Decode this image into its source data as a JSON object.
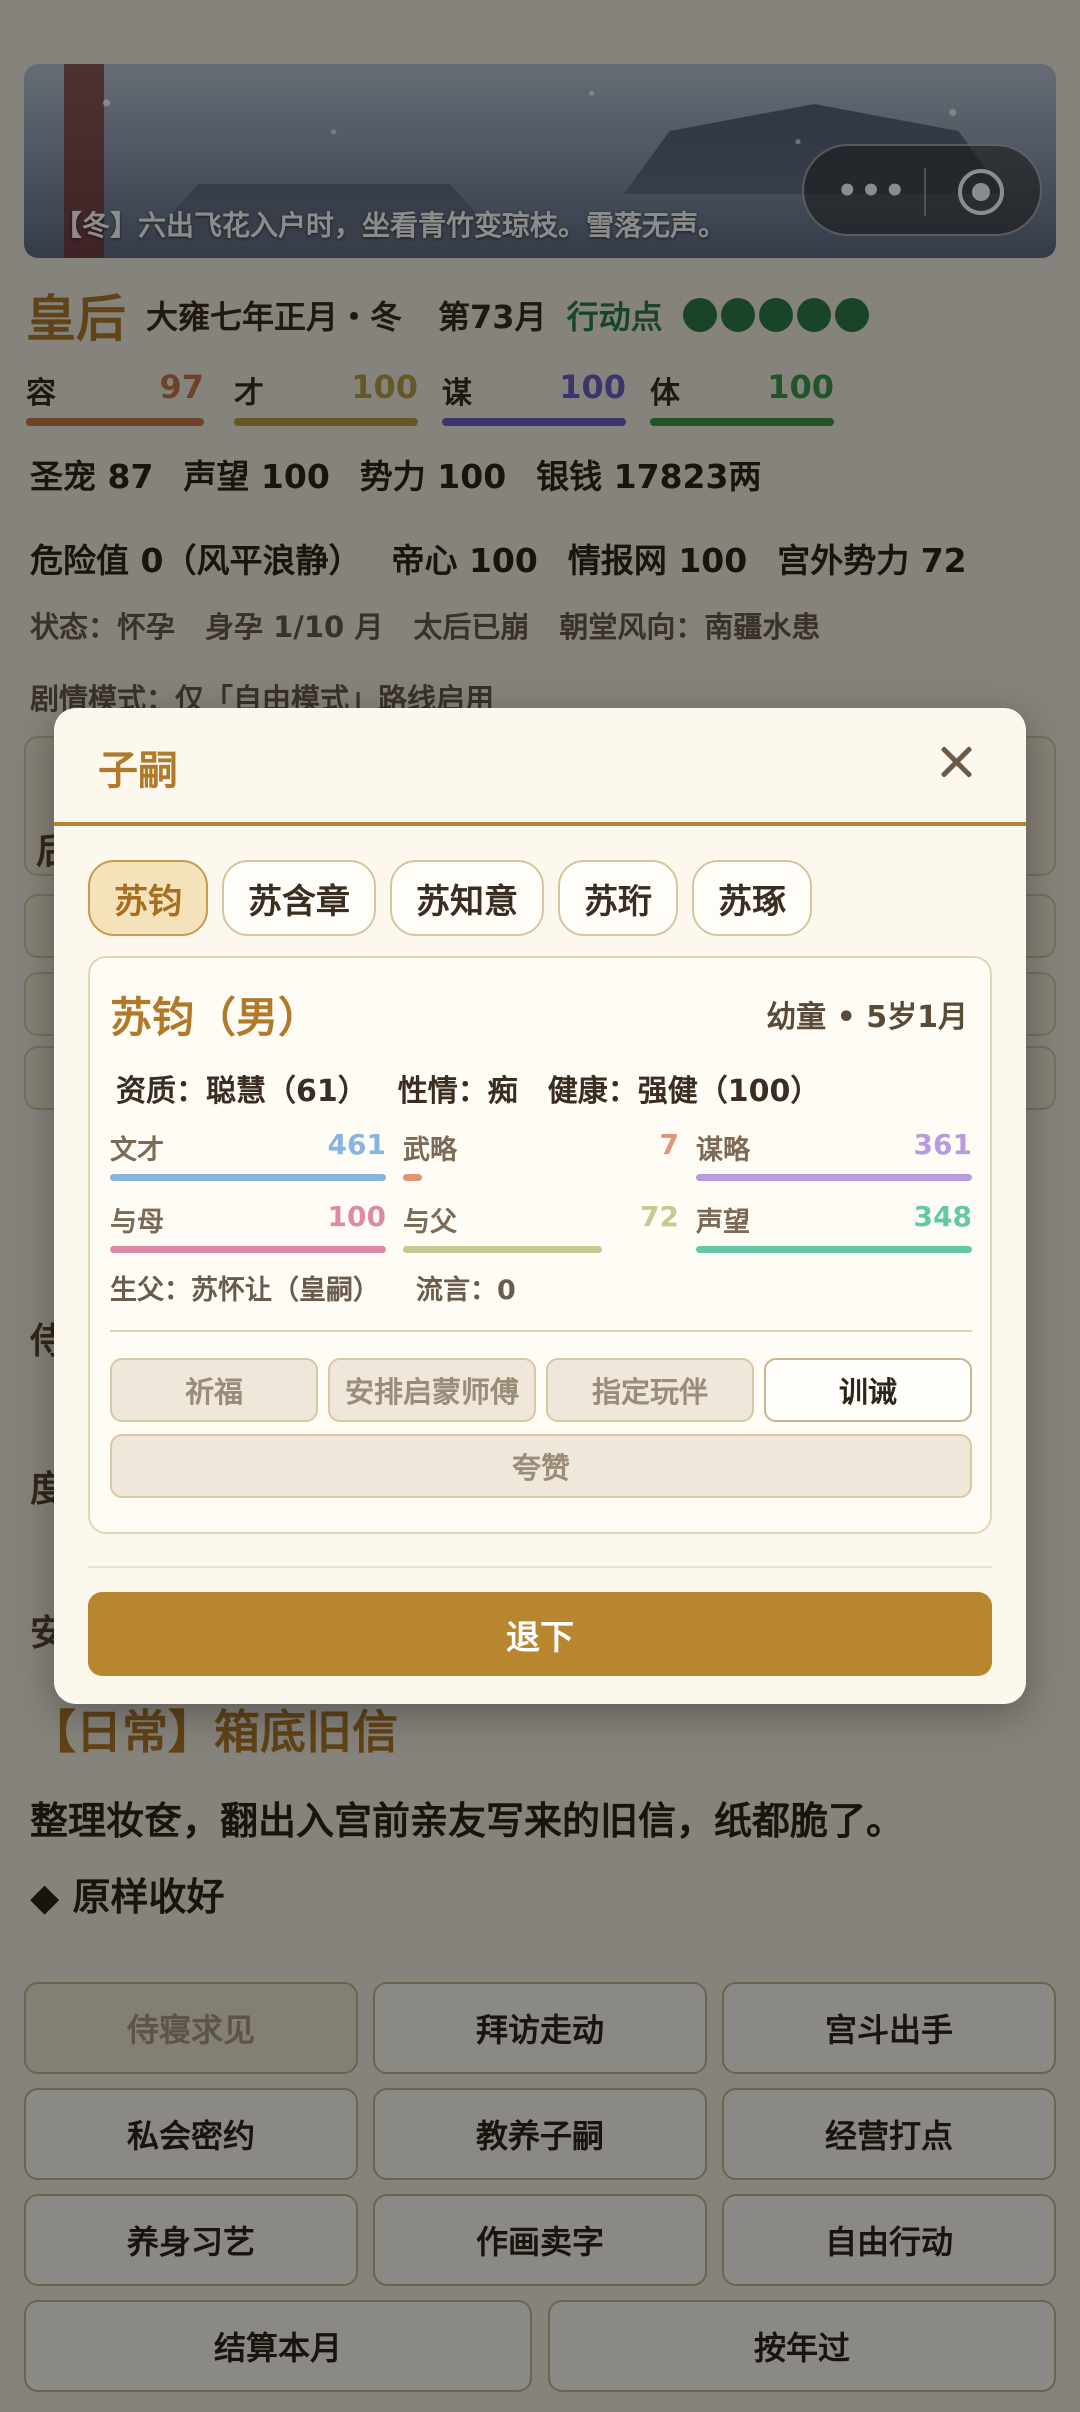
{
  "banner": {
    "caption": "【冬】六出飞花入户时，坐看青竹变琼枝。雪落无声。",
    "more_icon": "more-dots-icon",
    "close_icon": "target-circle-icon"
  },
  "header": {
    "title": "皇后",
    "date": "大雍七年正月・冬",
    "turn": "第73月",
    "ap_label": "行动点",
    "ap_dots": 5
  },
  "attributes": [
    {
      "label": "容",
      "value": "97",
      "color": "#c8794a"
    },
    {
      "label": "才",
      "value": "100",
      "color": "#b9a047"
    },
    {
      "label": "谋",
      "value": "100",
      "color": "#6c60c6"
    },
    {
      "label": "体",
      "value": "100",
      "color": "#3f9a4e"
    }
  ],
  "stats1": [
    "圣宠 87",
    "声望 100",
    "势力 100",
    "银钱 17823两"
  ],
  "stats2": [
    "危险值 0（风平浪静）",
    "帝心 100",
    "情报网 100",
    "宫外势力 72"
  ],
  "stats3": [
    "状态：怀孕",
    "身孕 1/10 月",
    "太后已崩",
    "朝堂风向：南疆水患"
  ],
  "story_mode": "剧情模式：仅「自由模式」路线启用",
  "background_partial": {
    "a": "后",
    "b": "侍",
    "c": "度",
    "d": "安"
  },
  "event": {
    "title": "【日常】箱底旧信",
    "desc": "整理妆奁，翻出入宫前亲友写来的旧信，纸都脆了。",
    "option": "◆ 原样收好"
  },
  "actions": [
    {
      "label": "侍寝求见",
      "disabled": true
    },
    {
      "label": "拜访走动",
      "disabled": false
    },
    {
      "label": "宫斗出手",
      "disabled": false
    },
    {
      "label": "私会密约",
      "disabled": false
    },
    {
      "label": "教养子嗣",
      "disabled": false
    },
    {
      "label": "经营打点",
      "disabled": false
    },
    {
      "label": "养身习艺",
      "disabled": false
    },
    {
      "label": "作画卖字",
      "disabled": false
    },
    {
      "label": "自由行动",
      "disabled": false
    },
    {
      "label": "结算本月",
      "disabled": false
    },
    {
      "label": "按年过",
      "disabled": false
    }
  ],
  "modal": {
    "title": "子嗣",
    "tabs": [
      "苏钧",
      "苏含章",
      "苏知意",
      "苏珩",
      "苏琢"
    ],
    "active_tab": 0,
    "child": {
      "name": "苏钧（男）",
      "age": "幼童 • 5岁1月",
      "aptitude": "资质：聪慧（61）",
      "temper": "性情：痴",
      "health": "健康：强健（100）",
      "stats": [
        {
          "label": "文才",
          "value": "461",
          "color": "#8ab4e0",
          "fill": 1.0
        },
        {
          "label": "武略",
          "value": "7",
          "color": "#e0957a",
          "fill": 0.07
        },
        {
          "label": "谋略",
          "value": "361",
          "color": "#b79ae0",
          "fill": 1.0
        },
        {
          "label": "与母",
          "value": "100",
          "color": "#dc8aa6",
          "fill": 1.0
        },
        {
          "label": "与父",
          "value": "72",
          "color": "#c3cc90",
          "fill": 0.72
        },
        {
          "label": "声望",
          "value": "348",
          "color": "#62c9a4",
          "fill": 1.0
        }
      ],
      "father": "生父：苏怀让（皇嗣）",
      "rumor": "流言：0"
    },
    "buttons": [
      {
        "label": "祈福",
        "enabled": false
      },
      {
        "label": "安排启蒙师傅",
        "enabled": false
      },
      {
        "label": "指定玩伴",
        "enabled": false
      },
      {
        "label": "训诫",
        "enabled": true
      },
      {
        "label": "夸赞",
        "enabled": false
      }
    ],
    "retreat": "退下"
  }
}
